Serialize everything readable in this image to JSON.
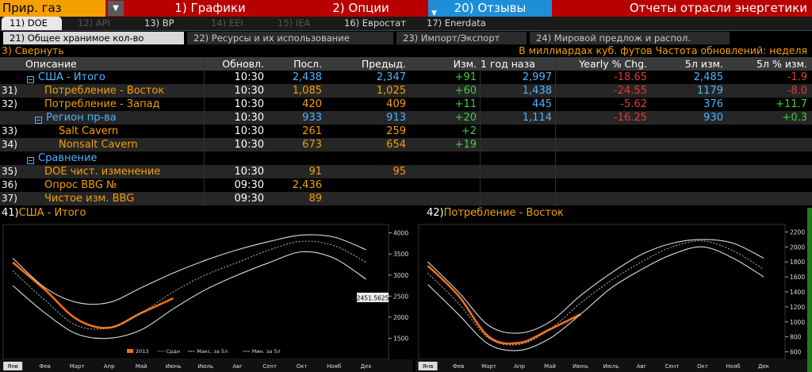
{
  "topbar": {
    "asset": "Прир. газ",
    "menu_graphs": "1) Графики",
    "menu_options": "2) Опции",
    "menu_feedback": "20) Отзывы",
    "title": "Отчеты отрасли энергетики"
  },
  "sources": [
    {
      "label": "11) DOE"
    },
    {
      "label": "12) API"
    },
    {
      "label": "13) BP"
    },
    {
      "label": "14) EEI"
    },
    {
      "label": "15) IEA"
    },
    {
      "label": "16) Евростат"
    },
    {
      "label": "17) Enerdata"
    }
  ],
  "subtabs": [
    {
      "label": "21) Общее хранимое кол-во"
    },
    {
      "label": "22) Ресурсы и их использование"
    },
    {
      "label": "23) Импорт/Экспорт"
    },
    {
      "label": "24) Мировой предлож и распол."
    }
  ],
  "info": {
    "collapse": "3) Свернуть",
    "units": "В миллиардах куб. футов  Частота обновлений: неделя"
  },
  "table": {
    "headers": {
      "desc": "Описание",
      "updated": "Обновл.",
      "last": "Посл.",
      "prev": "Предыд.",
      "chg": "Изм.",
      "year_ago": "1 год наза",
      "yearly_chg": "Yearly % Chg.",
      "y5": "5л изм.",
      "y5pct": "5л % изм."
    },
    "rows": [
      {
        "num": "",
        "desc": "США - Итого",
        "time": "10:30",
        "last": "2,438",
        "prev": "2,347",
        "chg": "+91",
        "year_ago": "2,997",
        "yearly": "-18.65",
        "y5": "2,485",
        "y5pct": "-1.9"
      },
      {
        "num": "31)",
        "desc": "Потребление - Восток",
        "time": "10:30",
        "last": "1,085",
        "prev": "1,025",
        "chg": "+60",
        "year_ago": "1,438",
        "yearly": "-24.55",
        "y5": "1179",
        "y5pct": "-8.0"
      },
      {
        "num": "32)",
        "desc": "Потребление - Запад",
        "time": "10:30",
        "last": "420",
        "prev": "409",
        "chg": "+11",
        "year_ago": "445",
        "yearly": "-5.62",
        "y5": "376",
        "y5pct": "+11.7"
      },
      {
        "num": "",
        "desc": "Регион пр-ва",
        "time": "10:30",
        "last": "933",
        "prev": "913",
        "chg": "+20",
        "year_ago": "1,114",
        "yearly": "-16.25",
        "y5": "930",
        "y5pct": "+0.3"
      },
      {
        "num": "33)",
        "desc": "Salt Cavern",
        "time": "10:30",
        "last": "261",
        "prev": "259",
        "chg": "+2",
        "year_ago": "",
        "yearly": "",
        "y5": "",
        "y5pct": ""
      },
      {
        "num": "34)",
        "desc": "Nonsalt Cavern",
        "time": "10:30",
        "last": "673",
        "prev": "654",
        "chg": "+19",
        "year_ago": "",
        "yearly": "",
        "y5": "",
        "y5pct": ""
      },
      {
        "num": "",
        "desc": "Сравнение",
        "time": "",
        "last": "",
        "prev": "",
        "chg": "",
        "year_ago": "",
        "yearly": "",
        "y5": "",
        "y5pct": ""
      },
      {
        "num": "35)",
        "desc": "DOE чист. изменение",
        "time": "10:30",
        "last": "91",
        "prev": "95",
        "chg": "",
        "year_ago": "",
        "yearly": "",
        "y5": "",
        "y5pct": ""
      },
      {
        "num": "36)",
        "desc": "Опрос BBG №",
        "time": "09:30",
        "last": "2,436",
        "prev": "",
        "chg": "",
        "year_ago": "",
        "yearly": "",
        "y5": "",
        "y5pct": ""
      },
      {
        "num": "37)",
        "desc": "Чистое изм. BBG",
        "time": "09:30",
        "last": "89",
        "prev": "",
        "chg": "",
        "year_ago": "",
        "yearly": "",
        "y5": "",
        "y5pct": ""
      }
    ]
  },
  "charts": {
    "left": {
      "num": "41)",
      "title": "США - Итого"
    },
    "right": {
      "num": "42)",
      "title": "Потребление - Восток"
    }
  },
  "chart_data": [
    {
      "type": "line",
      "title": "США - Итого",
      "x": [
        "Янв",
        "Фев",
        "Март",
        "Апр",
        "Май",
        "Июнь",
        "Июль",
        "Авг",
        "Сент",
        "Окт",
        "Нояб",
        "Дек"
      ],
      "ylim": [
        1000,
        4200
      ],
      "yticks": [
        1500,
        2000,
        2500,
        3000,
        3500,
        4000
      ],
      "last_value_label": "2451.5625",
      "legend": [
        "2013",
        "Срдн",
        "Макс. за 5л",
        "Мин. за 5л"
      ],
      "series": [
        {
          "name": "2013",
          "color": "#f07010",
          "values": [
            3300,
            2650,
            1950,
            1750,
            2100,
            2450
          ]
        },
        {
          "name": "Срдн",
          "color": "#bbbbbb",
          "values": [
            3100,
            2400,
            1800,
            1750,
            2100,
            2600,
            3000,
            3300,
            3600,
            3800,
            3700,
            3300
          ]
        },
        {
          "name": "Макс. за 5л",
          "color": "#dddddd",
          "values": [
            3400,
            2700,
            2350,
            2350,
            2700,
            3050,
            3350,
            3600,
            3800,
            3950,
            3900,
            3600
          ]
        },
        {
          "name": "Мин. за 5л",
          "color": "#dddddd",
          "values": [
            2750,
            2100,
            1600,
            1500,
            1700,
            2200,
            2650,
            3000,
            3300,
            3550,
            3400,
            2900
          ]
        }
      ]
    },
    {
      "type": "line",
      "title": "Потребление - Восток",
      "x": [
        "Янв",
        "Фев",
        "Март",
        "Апр",
        "Май",
        "Июнь",
        "Июль",
        "Авг",
        "Сент",
        "Окт",
        "Нояб",
        "Дек"
      ],
      "ylim": [
        500,
        2300
      ],
      "yticks": [
        600,
        800,
        1000,
        1200,
        1400,
        1600,
        1800,
        2000,
        2200
      ],
      "series": [
        {
          "name": "2013",
          "color": "#f07010",
          "values": [
            1750,
            1350,
            800,
            720,
            900,
            1100
          ]
        },
        {
          "name": "Срдн",
          "color": "#bbbbbb",
          "values": [
            1650,
            1250,
            780,
            700,
            900,
            1250,
            1550,
            1800,
            2000,
            2080,
            1950,
            1700
          ]
        },
        {
          "name": "Макс. за 5л",
          "color": "#dddddd",
          "values": [
            1800,
            1400,
            950,
            850,
            1000,
            1350,
            1650,
            1900,
            2050,
            2100,
            2050,
            1850
          ]
        },
        {
          "name": "Мин. за 5л",
          "color": "#dddddd",
          "values": [
            1500,
            1100,
            700,
            620,
            780,
            1100,
            1450,
            1700,
            1900,
            2000,
            1850,
            1600
          ]
        }
      ]
    }
  ]
}
